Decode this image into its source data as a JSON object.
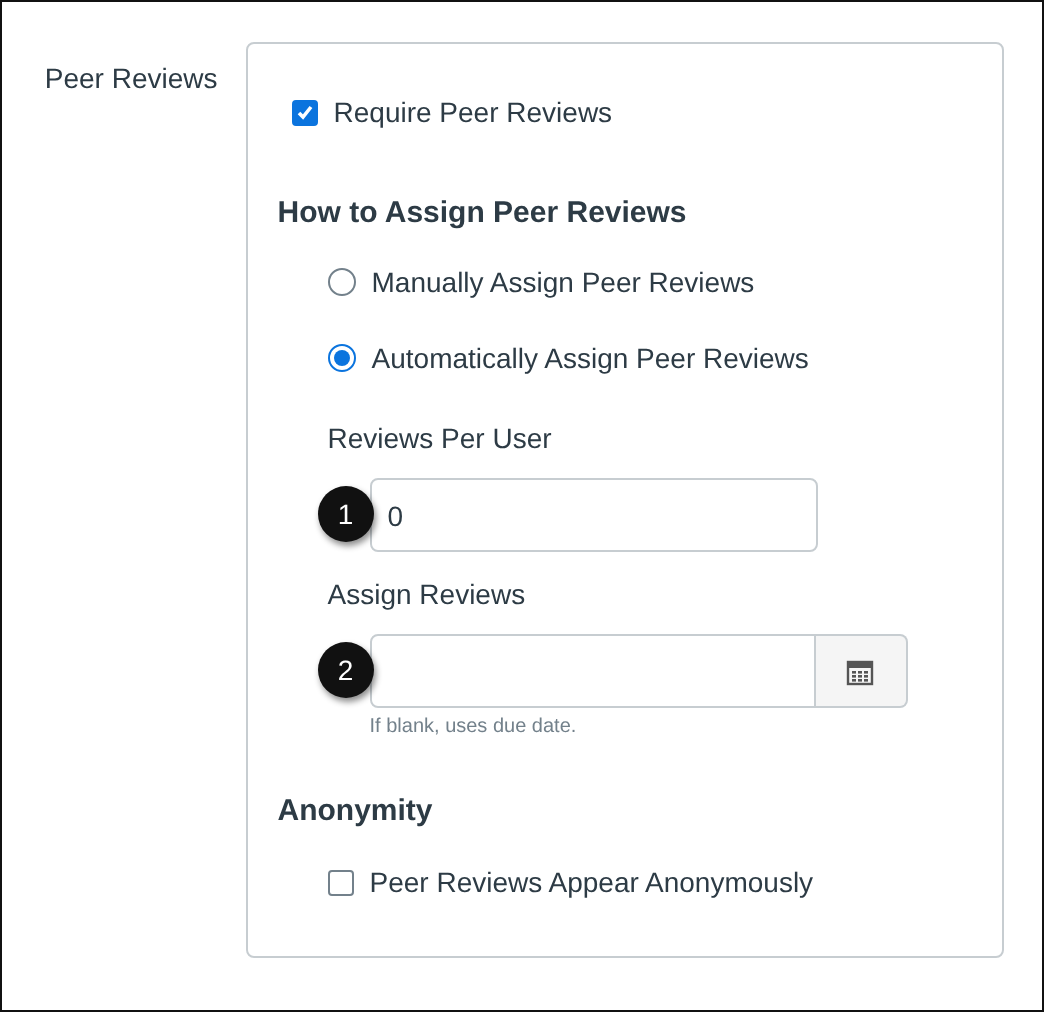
{
  "section_label": "Peer Reviews",
  "require_peer_reviews": {
    "label": "Require Peer Reviews",
    "checked": true
  },
  "assign_heading": "How to Assign Peer Reviews",
  "assign_options": [
    {
      "label": "Manually Assign Peer Reviews",
      "selected": false
    },
    {
      "label": "Automatically Assign Peer Reviews",
      "selected": true
    }
  ],
  "reviews_per_user": {
    "label": "Reviews Per User",
    "value": "0",
    "callout": "1"
  },
  "assign_reviews": {
    "label": "Assign Reviews",
    "callout": "2",
    "hint": "If blank, uses due date."
  },
  "anonymity_heading": "Anonymity",
  "anonymous": {
    "label": "Peer Reviews Appear Anonymously",
    "checked": false
  }
}
